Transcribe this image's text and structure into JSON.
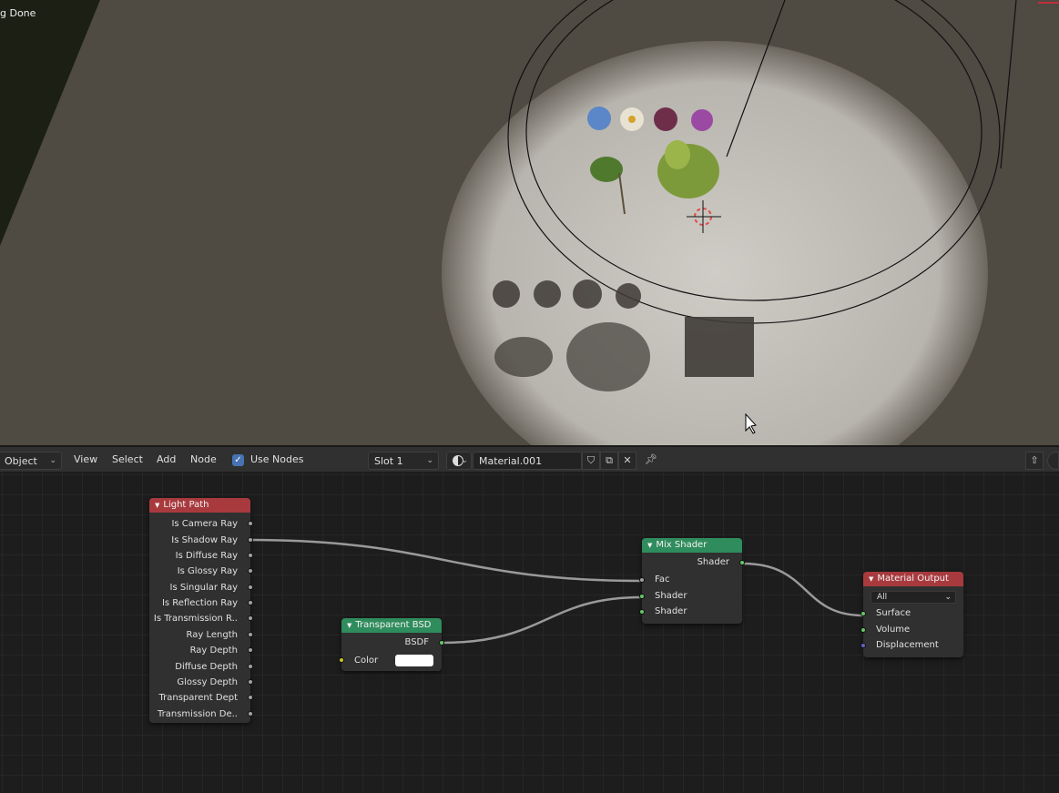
{
  "viewport": {
    "status_text": "g Done"
  },
  "header": {
    "mode_label": "Object",
    "menus": [
      "View",
      "Select",
      "Add",
      "Node"
    ],
    "use_nodes_label": "Use Nodes",
    "use_nodes_checked": true,
    "slot_label": "Slot 1",
    "material_name": "Material.001"
  },
  "nodes": {
    "light_path": {
      "title": "Light Path",
      "header_color": "#a83a3e",
      "outputs": [
        "Is Camera Ray",
        "Is Shadow Ray",
        "Is Diffuse Ray",
        "Is Glossy Ray",
        "Is Singular Ray",
        "Is Reflection Ray",
        "Is Transmission R..",
        "Ray Length",
        "Ray Depth",
        "Diffuse Depth",
        "Glossy Depth",
        "Transparent Dept",
        "Transmission De.."
      ]
    },
    "transparent_bsdf": {
      "title": "Transparent BSD",
      "header_color": "#2f8c5d",
      "output": "BSDF",
      "input_color_label": "Color",
      "color_value": "#ffffff"
    },
    "mix_shader": {
      "title": "Mix Shader",
      "header_color": "#2f8c5d",
      "output": "Shader",
      "inputs": [
        "Fac",
        "Shader",
        "Shader"
      ]
    },
    "material_output": {
      "title": "Material Output",
      "header_color": "#a83a3e",
      "target": "All",
      "inputs": [
        "Surface",
        "Volume",
        "Displacement"
      ]
    }
  },
  "colors": {
    "socket_grey": "#a1a1a1",
    "socket_green": "#63c763",
    "socket_yellow": "#c7c729",
    "socket_blue": "#6363c7",
    "accent": "#4772b3"
  }
}
